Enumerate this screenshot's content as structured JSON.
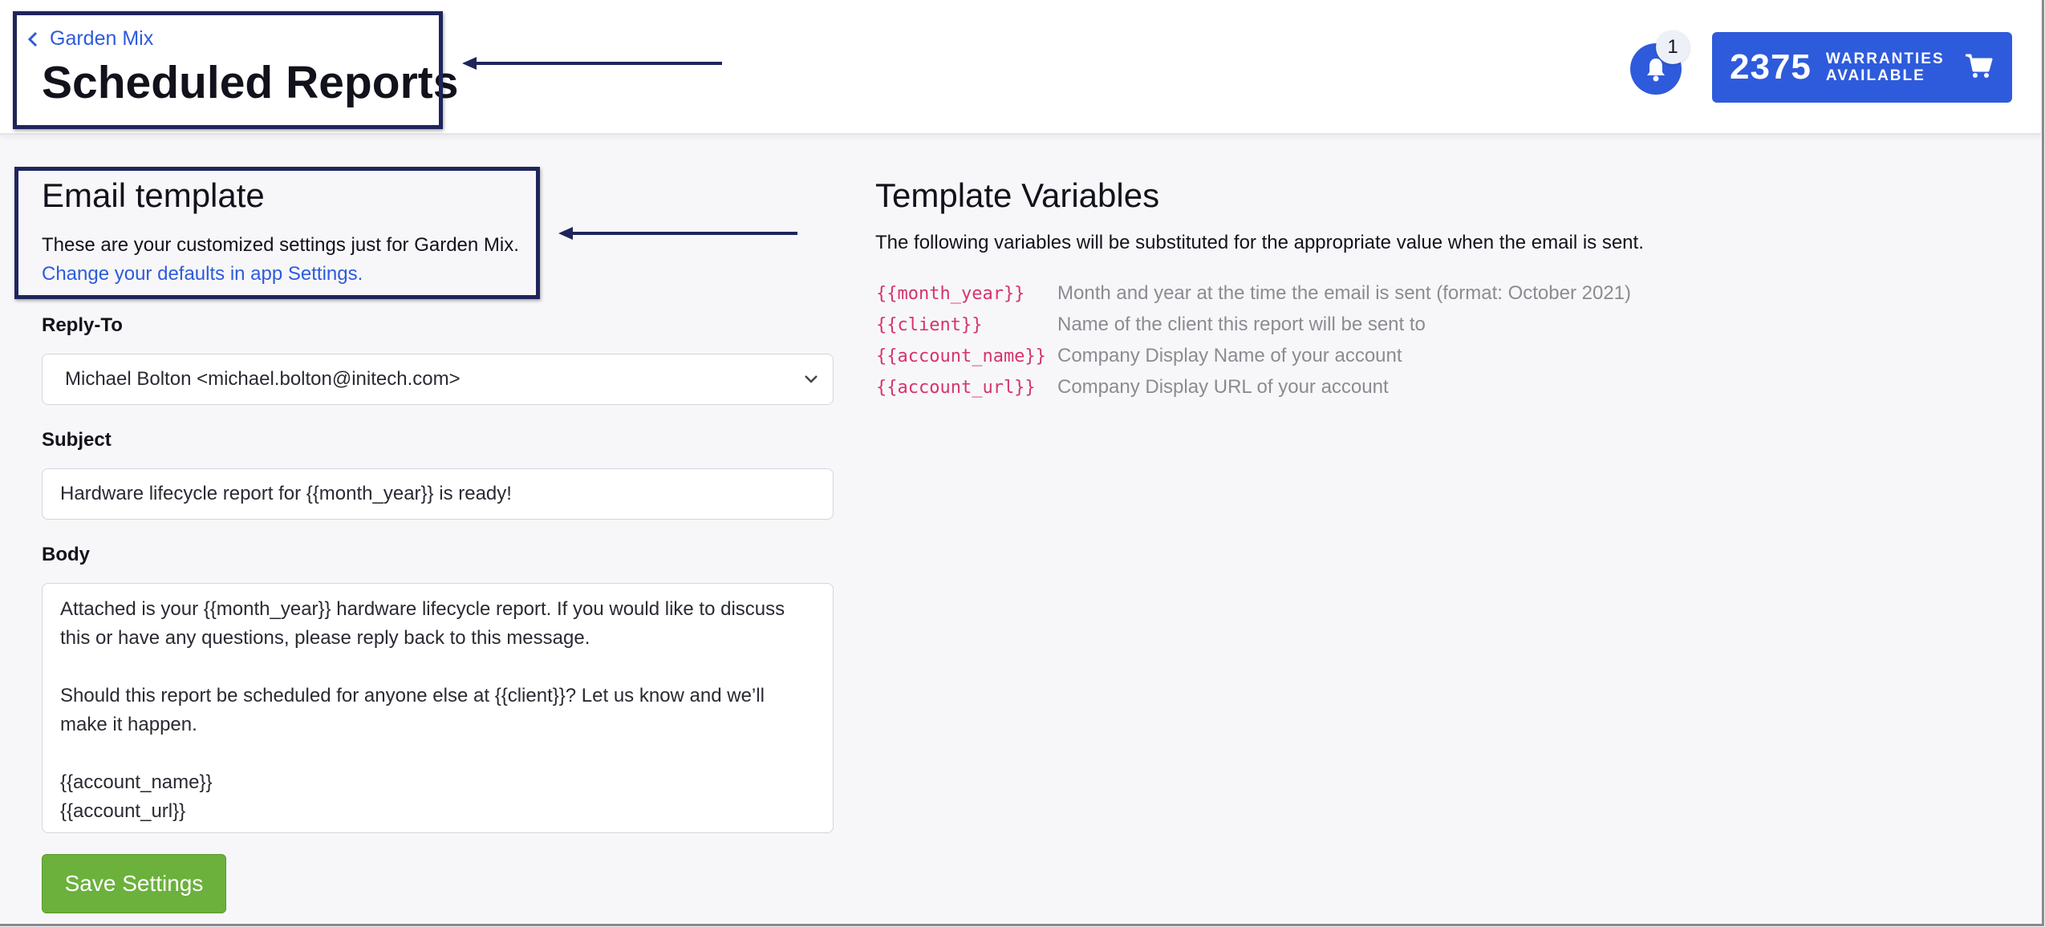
{
  "header": {
    "breadcrumb": "Garden Mix",
    "title": "Scheduled Reports",
    "notification_count": "1",
    "warranties_count": "2375",
    "warranties_label_line1": "WARRANTIES",
    "warranties_label_line2": "AVAILABLE"
  },
  "email_template": {
    "title": "Email template",
    "description": "These are your customized settings just for Garden Mix.",
    "defaults_link": "Change your defaults in app Settings.",
    "reply_to_label": "Reply-To",
    "reply_to_value": "Michael Bolton <michael.bolton@initech.com>",
    "subject_label": "Subject",
    "subject_value": "Hardware lifecycle report for {{month_year}} is ready!",
    "body_label": "Body",
    "body_value": "Attached is your {{month_year}} hardware lifecycle report. If you would like to discuss\nthis or have any questions, please reply back to this message.\n\nShould this report be scheduled for anyone else at {{client}}? Let us know and we’ll\nmake it happen.\n\n{{account_name}}\n{{account_url}}",
    "save_label": "Save Settings"
  },
  "template_variables": {
    "title": "Template Variables",
    "description": "The following variables will be substituted for the appropriate value when the email is sent.",
    "items": [
      {
        "code": "{{month_year}}",
        "desc": "Month and year at the time the email is sent (format: October 2021)"
      },
      {
        "code": "{{client}}",
        "desc": "Name of the client this report will be sent to"
      },
      {
        "code": "{{account_name}}",
        "desc": "Company Display Name of your account"
      },
      {
        "code": "{{account_url}}",
        "desc": "Company Display URL of your account"
      }
    ]
  },
  "colors": {
    "accent": "#2e5bdc",
    "save_button": "#6bb13c",
    "variable_code": "#d6336c",
    "annotation": "#1f255c"
  },
  "icons": [
    "chevron-left-icon",
    "bell-icon",
    "cart-icon",
    "chevron-down-icon",
    "arrow-left-icon"
  ]
}
